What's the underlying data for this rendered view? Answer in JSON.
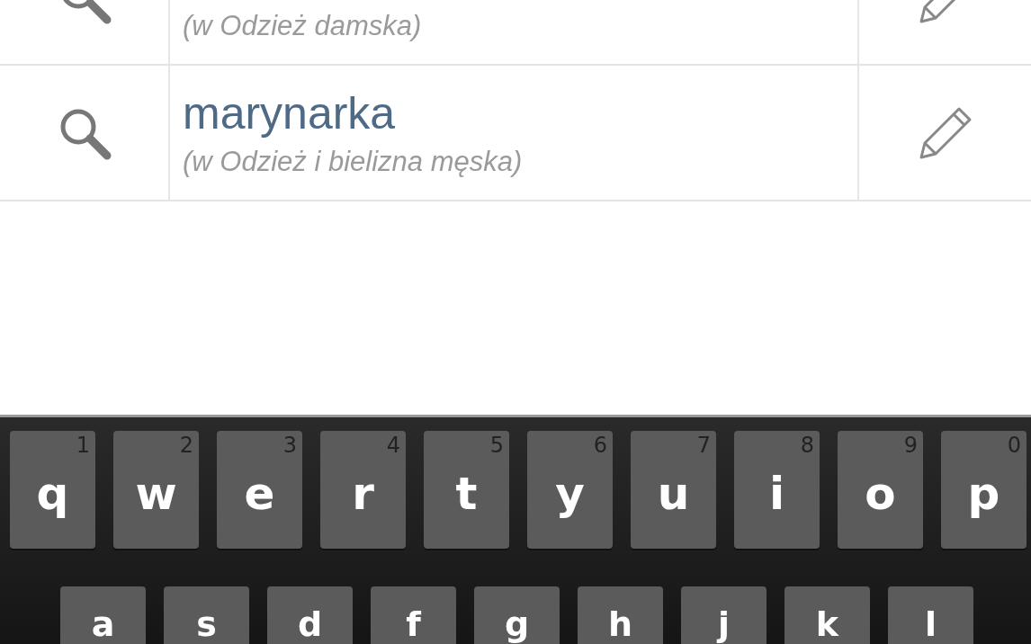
{
  "suggestions": [
    {
      "subtitle": "(w Odzież damska)"
    },
    {
      "title": "marynarka",
      "subtitle": "(w Odzież i bielizna męska)"
    }
  ],
  "keyboard": {
    "rows": [
      [
        {
          "letter": "q",
          "digit": "1"
        },
        {
          "letter": "w",
          "digit": "2"
        },
        {
          "letter": "e",
          "digit": "3"
        },
        {
          "letter": "r",
          "digit": "4"
        },
        {
          "letter": "t",
          "digit": "5"
        },
        {
          "letter": "y",
          "digit": "6"
        },
        {
          "letter": "u",
          "digit": "7"
        },
        {
          "letter": "i",
          "digit": "8"
        },
        {
          "letter": "o",
          "digit": "9"
        },
        {
          "letter": "p",
          "digit": "0"
        }
      ],
      [
        {
          "letter": "a"
        },
        {
          "letter": "s"
        },
        {
          "letter": "d"
        },
        {
          "letter": "f"
        },
        {
          "letter": "g"
        },
        {
          "letter": "h"
        },
        {
          "letter": "j"
        },
        {
          "letter": "k"
        },
        {
          "letter": "l"
        }
      ]
    ]
  }
}
